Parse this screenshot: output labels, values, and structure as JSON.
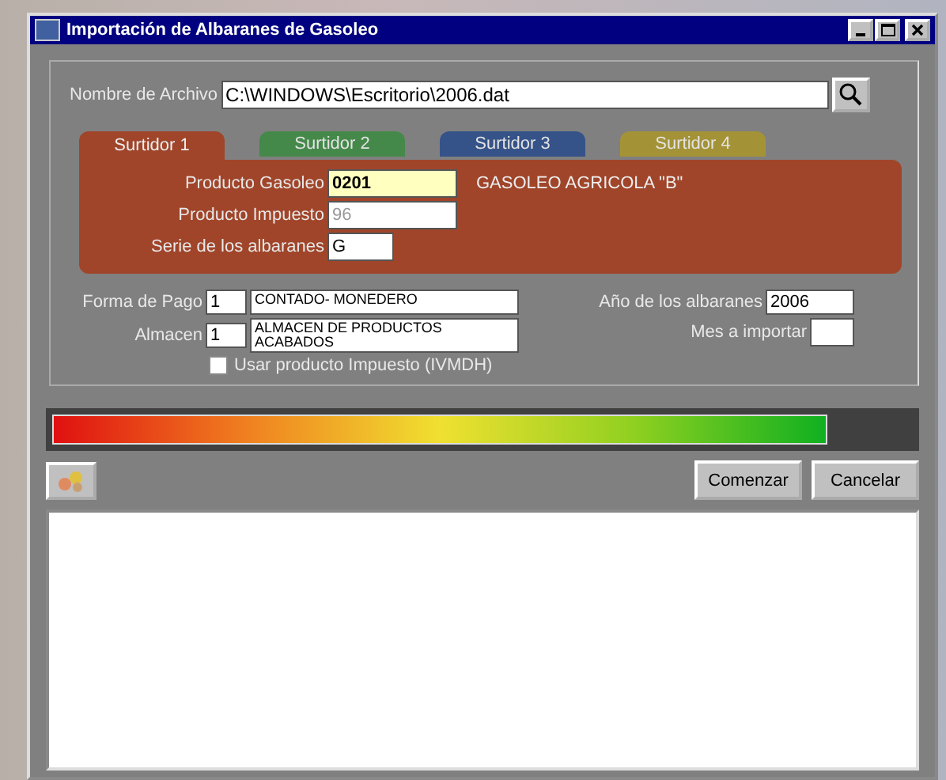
{
  "window": {
    "title": "Importación de Albaranes de Gasoleo"
  },
  "file": {
    "label": "Nombre de Archivo",
    "value": "C:\\WINDOWS\\Escritorio\\2006.dat"
  },
  "tabs": [
    {
      "label": "Surtidor 1",
      "selected": true,
      "color": "#a0452a"
    },
    {
      "label": "Surtidor 2",
      "selected": false,
      "color": "#3f8a45"
    },
    {
      "label": "Surtidor 3",
      "selected": false,
      "color": "#2f4f8a"
    },
    {
      "label": "Surtidor 4",
      "selected": false,
      "color": "#a8962e"
    }
  ],
  "tab_fields": {
    "producto_gasoleo": {
      "label": "Producto Gasoleo",
      "value": "0201",
      "description": "GASOLEO AGRICOLA \"B\""
    },
    "producto_impuesto": {
      "label": "Producto Impuesto",
      "value": "96",
      "disabled": true
    },
    "serie": {
      "label": "Serie de los albaranes",
      "value": "G"
    }
  },
  "forma_pago": {
    "label": "Forma de Pago",
    "code": "1",
    "description": "CONTADO- MONEDERO"
  },
  "almacen": {
    "label": "Almacen",
    "code": "1",
    "description": "ALMACEN DE PRODUCTOS ACABADOS"
  },
  "anio": {
    "label": "Año de los albaranes",
    "value": "2006"
  },
  "mes": {
    "label": "Mes a importar"
  },
  "usar_impuesto": {
    "label": "Usar producto Impuesto (IVMDH)",
    "checked": false
  },
  "progress": {
    "level": 0.9
  },
  "buttons": [
    {
      "label": "Comenzar"
    },
    {
      "label": "Cancelar"
    }
  ]
}
